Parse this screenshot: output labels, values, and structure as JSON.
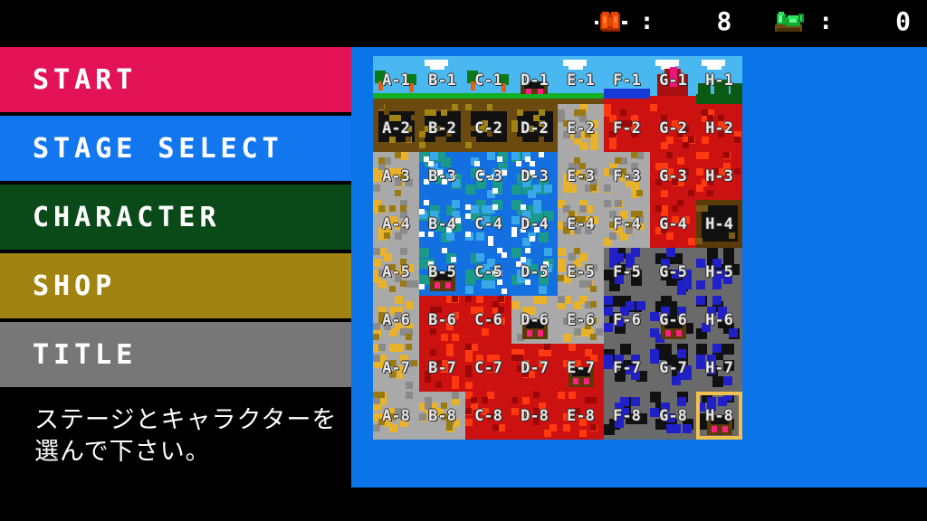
{
  "status": {
    "items": [
      {
        "icon": "meat-icon",
        "label": ":",
        "value": "8"
      },
      {
        "icon": "emerald-gem-icon",
        "label": ":",
        "value": "0"
      }
    ]
  },
  "menu": {
    "items": [
      {
        "label": "START",
        "color": "#e31155",
        "text_color": "#ffffff"
      },
      {
        "label": "STAGE SELECT",
        "color": "#1277ee",
        "text_color": "#ffffff"
      },
      {
        "label": "CHARACTER",
        "color": "#0a4a18",
        "text_color": "#ffffff"
      },
      {
        "label": "SHOP",
        "color": "#a08310",
        "text_color": "#ffffff"
      },
      {
        "label": "TITLE",
        "color": "#777777",
        "text_color": "#ffffff"
      }
    ]
  },
  "help": {
    "line1": "ステージとキャラクターを",
    "line2": "選んで下さい。"
  },
  "map": {
    "panel_color": "#0a74e8",
    "selected": "H-8",
    "selection_color": "#f0c050",
    "columns": [
      "A",
      "B",
      "C",
      "D",
      "E",
      "F",
      "G",
      "H"
    ],
    "rows": [
      "1",
      "2",
      "3",
      "4",
      "5",
      "6",
      "7",
      "8"
    ],
    "cells": [
      {
        "id": "A-1",
        "terrain": "sky-tree"
      },
      {
        "id": "B-1",
        "terrain": "sky-cloud"
      },
      {
        "id": "C-1",
        "terrain": "sky-tree"
      },
      {
        "id": "D-1",
        "terrain": "sky-cave"
      },
      {
        "id": "E-1",
        "terrain": "sky-cloud"
      },
      {
        "id": "F-1",
        "terrain": "sky-water"
      },
      {
        "id": "G-1",
        "terrain": "sky-volcano"
      },
      {
        "id": "H-1",
        "terrain": "sky-forest"
      },
      {
        "id": "A-2",
        "terrain": "underground"
      },
      {
        "id": "B-2",
        "terrain": "underground"
      },
      {
        "id": "C-2",
        "terrain": "underground"
      },
      {
        "id": "D-2",
        "terrain": "underground"
      },
      {
        "id": "E-2",
        "terrain": "rocky-gold"
      },
      {
        "id": "F-2",
        "terrain": "lava"
      },
      {
        "id": "G-2",
        "terrain": "lava"
      },
      {
        "id": "H-2",
        "terrain": "lava"
      },
      {
        "id": "A-3",
        "terrain": "rocky-gold"
      },
      {
        "id": "B-3",
        "terrain": "water-ice"
      },
      {
        "id": "C-3",
        "terrain": "water-ice"
      },
      {
        "id": "D-3",
        "terrain": "water-ice"
      },
      {
        "id": "E-3",
        "terrain": "rocky-gold"
      },
      {
        "id": "F-3",
        "terrain": "rocky-gold"
      },
      {
        "id": "G-3",
        "terrain": "lava"
      },
      {
        "id": "H-3",
        "terrain": "lava"
      },
      {
        "id": "A-4",
        "terrain": "rocky-gold"
      },
      {
        "id": "B-4",
        "terrain": "water-ice"
      },
      {
        "id": "C-4",
        "terrain": "water-ice"
      },
      {
        "id": "D-4",
        "terrain": "water-ice"
      },
      {
        "id": "E-4",
        "terrain": "rocky-gold"
      },
      {
        "id": "F-4",
        "terrain": "rocky-gold"
      },
      {
        "id": "G-4",
        "terrain": "lava"
      },
      {
        "id": "H-4",
        "terrain": "cave-entrance"
      },
      {
        "id": "A-5",
        "terrain": "rocky-gold"
      },
      {
        "id": "B-5",
        "terrain": "water-cave"
      },
      {
        "id": "C-5",
        "terrain": "water-ice"
      },
      {
        "id": "D-5",
        "terrain": "water-ice"
      },
      {
        "id": "E-5",
        "terrain": "rocky-gold"
      },
      {
        "id": "F-5",
        "terrain": "dark-cave"
      },
      {
        "id": "G-5",
        "terrain": "dark-cave"
      },
      {
        "id": "H-5",
        "terrain": "dark-cave"
      },
      {
        "id": "A-6",
        "terrain": "rocky-gold"
      },
      {
        "id": "B-6",
        "terrain": "lava"
      },
      {
        "id": "C-6",
        "terrain": "lava"
      },
      {
        "id": "D-6",
        "terrain": "rocky-cave"
      },
      {
        "id": "E-6",
        "terrain": "rocky-gold"
      },
      {
        "id": "F-6",
        "terrain": "dark-cave"
      },
      {
        "id": "G-6",
        "terrain": "dark-cave-entrance"
      },
      {
        "id": "H-6",
        "terrain": "dark-cave"
      },
      {
        "id": "A-7",
        "terrain": "rocky-gold"
      },
      {
        "id": "B-7",
        "terrain": "lava"
      },
      {
        "id": "C-7",
        "terrain": "lava"
      },
      {
        "id": "D-7",
        "terrain": "lava"
      },
      {
        "id": "E-7",
        "terrain": "lava-cave"
      },
      {
        "id": "F-7",
        "terrain": "dark-cave"
      },
      {
        "id": "G-7",
        "terrain": "dark-cave"
      },
      {
        "id": "H-7",
        "terrain": "dark-cave"
      },
      {
        "id": "A-8",
        "terrain": "rocky-gold"
      },
      {
        "id": "B-8",
        "terrain": "rocky-gold"
      },
      {
        "id": "C-8",
        "terrain": "lava"
      },
      {
        "id": "D-8",
        "terrain": "lava"
      },
      {
        "id": "E-8",
        "terrain": "lava"
      },
      {
        "id": "F-8",
        "terrain": "dark-cave"
      },
      {
        "id": "G-8",
        "terrain": "dark-cave"
      },
      {
        "id": "H-8",
        "terrain": "dark-cave-entrance"
      }
    ]
  },
  "colors": {
    "background": "#000000",
    "sky": "#4ab8f0",
    "grass": "#12b022",
    "dirt": "#6b4a10",
    "rock": "#a9a9a9",
    "gold": "#e8b22a",
    "water": "#1470e0",
    "ice": "#1a9a8a",
    "lava": "#cc1111",
    "lava_bright": "#ff3a10",
    "dark": "#111111",
    "blue_dark": "#2020c8",
    "cave_brown": "#5a3a08",
    "pink": "#ff2080"
  }
}
